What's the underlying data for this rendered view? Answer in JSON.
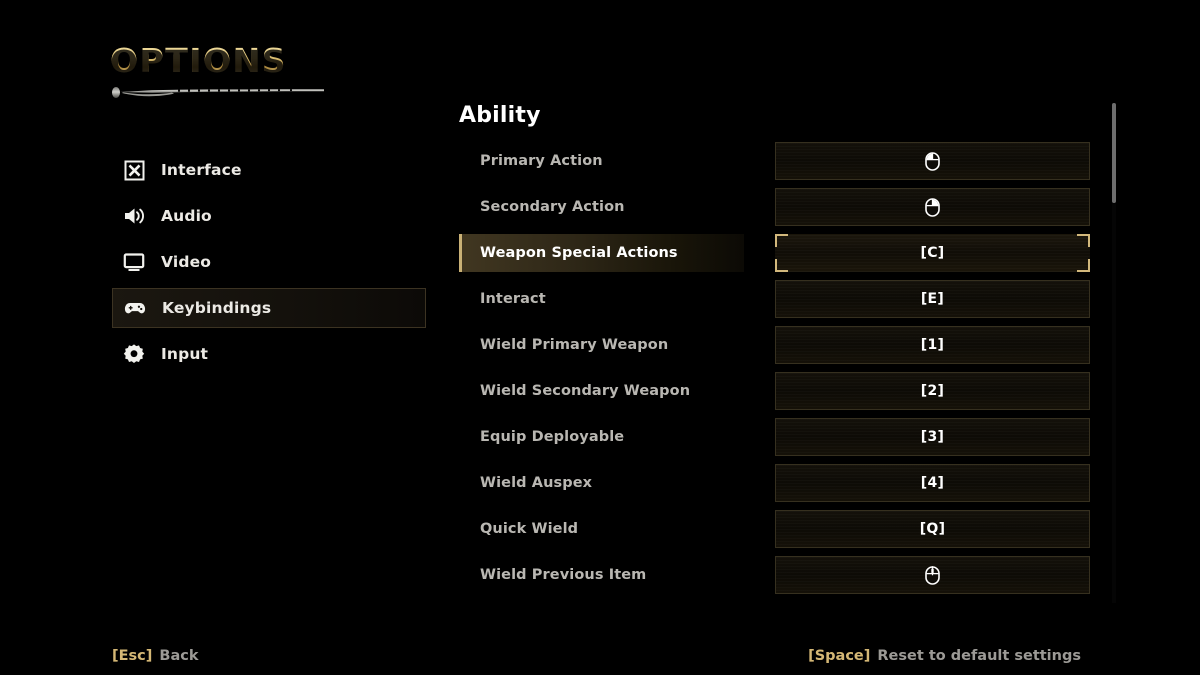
{
  "header": {
    "title": "OPTIONS",
    "ornament_icon": "sword-ornament"
  },
  "sidebar": {
    "items": [
      {
        "label": "Interface",
        "icon": "interface-x-box-icon",
        "selected": false
      },
      {
        "label": "Audio",
        "icon": "speaker-icon",
        "selected": false
      },
      {
        "label": "Video",
        "icon": "monitor-icon",
        "selected": false
      },
      {
        "label": "Keybindings",
        "icon": "gamepad-icon",
        "selected": true
      },
      {
        "label": "Input",
        "icon": "gear-icon",
        "selected": false
      }
    ]
  },
  "main": {
    "section_title": "Ability",
    "rows": [
      {
        "label": "Primary Action",
        "binding": "",
        "icon": "mouse-left-button-icon",
        "selected": false
      },
      {
        "label": "Secondary Action",
        "binding": "",
        "icon": "mouse-right-button-icon",
        "selected": false
      },
      {
        "label": "Weapon Special Actions",
        "binding": "[C]",
        "icon": "",
        "selected": true
      },
      {
        "label": "Interact",
        "binding": "[E]",
        "icon": "",
        "selected": false
      },
      {
        "label": "Wield Primary Weapon",
        "binding": "[1]",
        "icon": "",
        "selected": false
      },
      {
        "label": "Wield Secondary Weapon",
        "binding": "[2]",
        "icon": "",
        "selected": false
      },
      {
        "label": "Equip Deployable",
        "binding": "[3]",
        "icon": "",
        "selected": false
      },
      {
        "label": "Wield Auspex",
        "binding": "[4]",
        "icon": "",
        "selected": false
      },
      {
        "label": "Quick Wield",
        "binding": "[Q]",
        "icon": "",
        "selected": false
      },
      {
        "label": "Wield Previous Item",
        "binding": "",
        "icon": "mouse-middle-button-icon",
        "selected": false
      }
    ]
  },
  "scrollbar": {
    "name": "vertical-scrollbar",
    "thumb_top_pct": 0,
    "thumb_height_pct": 20
  },
  "footer": {
    "back_key": "[Esc]",
    "back_label": "Back",
    "reset_key": "[Space]",
    "reset_label": "Reset to default settings"
  },
  "colors": {
    "gold": "#d2b87c",
    "title_gold": "#d8bb6e",
    "text_primary": "#ffffff",
    "text_muted": "#b9b7b2",
    "background": "#000000",
    "border": "#36301f"
  }
}
